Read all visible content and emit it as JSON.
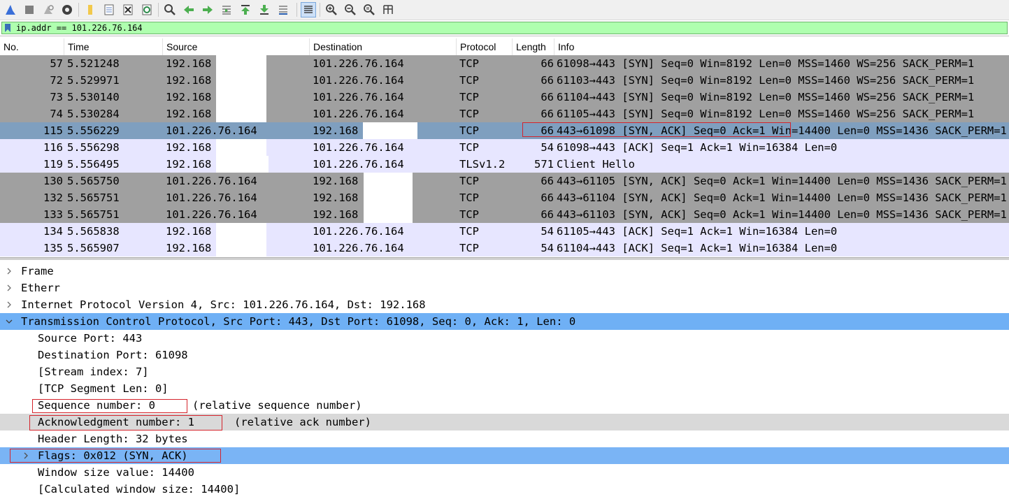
{
  "toolbar": {
    "icons": [
      "shark-fin-start-icon",
      "stop-capture-icon",
      "restart-capture-icon",
      "capture-options-icon",
      "open-file-icon",
      "file-set-icon",
      "close-file-icon",
      "reload-icon",
      "find-packet-icon",
      "go-back-icon",
      "go-forward-icon",
      "go-to-packet-icon",
      "go-first-icon",
      "go-last-icon",
      "autoscroll-icon",
      "colorize-icon",
      "zoom-in-icon",
      "zoom-out-icon",
      "zoom-normal-icon",
      "resize-columns-icon"
    ]
  },
  "filter": {
    "value": "ip.addr == 101.226.76.164"
  },
  "columns": [
    "No.",
    "Time",
    "Source",
    "Destination",
    "Protocol",
    "Length",
    "Info"
  ],
  "packets": [
    {
      "no": "57",
      "time": "5.521248",
      "src": "192.168",
      "dst": "101.226.76.164",
      "proto": "TCP",
      "len": "66",
      "info": "61098→443 [SYN] Seq=0 Win=8192 Len=0 MSS=1460 WS=256 SACK_PERM=1"
    },
    {
      "no": "72",
      "time": "5.529971",
      "src": "192.168",
      "dst": "101.226.76.164",
      "proto": "TCP",
      "len": "66",
      "info": "61103→443 [SYN] Seq=0 Win=8192 Len=0 MSS=1460 WS=256 SACK_PERM=1"
    },
    {
      "no": "73",
      "time": "5.530140",
      "src": "192.168",
      "dst": "101.226.76.164",
      "proto": "TCP",
      "len": "66",
      "info": "61104→443 [SYN] Seq=0 Win=8192 Len=0 MSS=1460 WS=256 SACK_PERM=1"
    },
    {
      "no": "74",
      "time": "5.530284",
      "src": "192.168",
      "dst": "101.226.76.164",
      "proto": "TCP",
      "len": "66",
      "info": "61105→443 [SYN] Seq=0 Win=8192 Len=0 MSS=1460 WS=256 SACK_PERM=1"
    },
    {
      "no": "115",
      "time": "5.556229",
      "src": "101.226.76.164",
      "dst": "192.168",
      "proto": "TCP",
      "len": "66",
      "info": "443→61098 [SYN, ACK] Seq=0 Ack=1 Win=14400 Len=0 MSS=1436 SACK_PERM=1"
    },
    {
      "no": "116",
      "time": "5.556298",
      "src": "192.168",
      "dst": "101.226.76.164",
      "proto": "TCP",
      "len": "54",
      "info": "61098→443 [ACK] Seq=1 Ack=1 Win=16384 Len=0"
    },
    {
      "no": "119",
      "time": "5.556495",
      "src": "192.168",
      "dst": "101.226.76.164",
      "proto": "TLSv1.2",
      "len": "571",
      "info": "Client Hello"
    },
    {
      "no": "130",
      "time": "5.565750",
      "src": "101.226.76.164",
      "dst": "192.168",
      "proto": "TCP",
      "len": "66",
      "info": "443→61105 [SYN, ACK] Seq=0 Ack=1 Win=14400 Len=0 MSS=1436 SACK_PERM=1"
    },
    {
      "no": "132",
      "time": "5.565751",
      "src": "101.226.76.164",
      "dst": "192.168",
      "proto": "TCP",
      "len": "66",
      "info": "443→61104 [SYN, ACK] Seq=0 Ack=1 Win=14400 Len=0 MSS=1436 SACK_PERM=1"
    },
    {
      "no": "133",
      "time": "5.565751",
      "src": "101.226.76.164",
      "dst": "192.168",
      "proto": "TCP",
      "len": "66",
      "info": "443→61103 [SYN, ACK] Seq=0 Ack=1 Win=14400 Len=0 MSS=1436 SACK_PERM=1"
    },
    {
      "no": "134",
      "time": "5.565838",
      "src": "192.168",
      "dst": "101.226.76.164",
      "proto": "TCP",
      "len": "54",
      "info": "61105→443 [ACK] Seq=1 Ack=1 Win=16384 Len=0"
    },
    {
      "no": "135",
      "time": "5.565907",
      "src": "192.168",
      "dst": "101.226.76.164",
      "proto": "TCP",
      "len": "54",
      "info": "61104→443 [ACK] Seq=1 Ack=1 Win=16384 Len=0"
    }
  ],
  "details": {
    "frame": "Frame",
    "ethernet": "Etherr",
    "ip": "Internet Protocol Version 4, Src: 101.226.76.164, Dst: 192.168",
    "tcp": "Transmission Control Protocol, Src Port: 443, Dst Port: 61098, Seq: 0, Ack: 1, Len: 0",
    "src_port": "Source Port: 443",
    "dst_port": "Destination Port: 61098",
    "stream_index": "[Stream index: 7]",
    "seg_len": "[TCP Segment Len: 0]",
    "seq": "Sequence number: 0",
    "seq_note": "(relative sequence number)",
    "ack": "Acknowledgment number: 1",
    "ack_note": "(relative ack number)",
    "hdr_len": "Header Length: 32 bytes",
    "flags": "Flags: 0x012 (SYN, ACK)",
    "win": "Window size value: 14400",
    "calc_win": "[Calculated window size: 14400]"
  },
  "colors": {
    "row_gray": "#a0a0a0",
    "row_lavender": "#e7e6ff",
    "row_selected": "#7f9fbf",
    "detail_selected": "#6fb0f5",
    "filter_green": "#afffaf",
    "annotation_red": "#d4242c"
  }
}
